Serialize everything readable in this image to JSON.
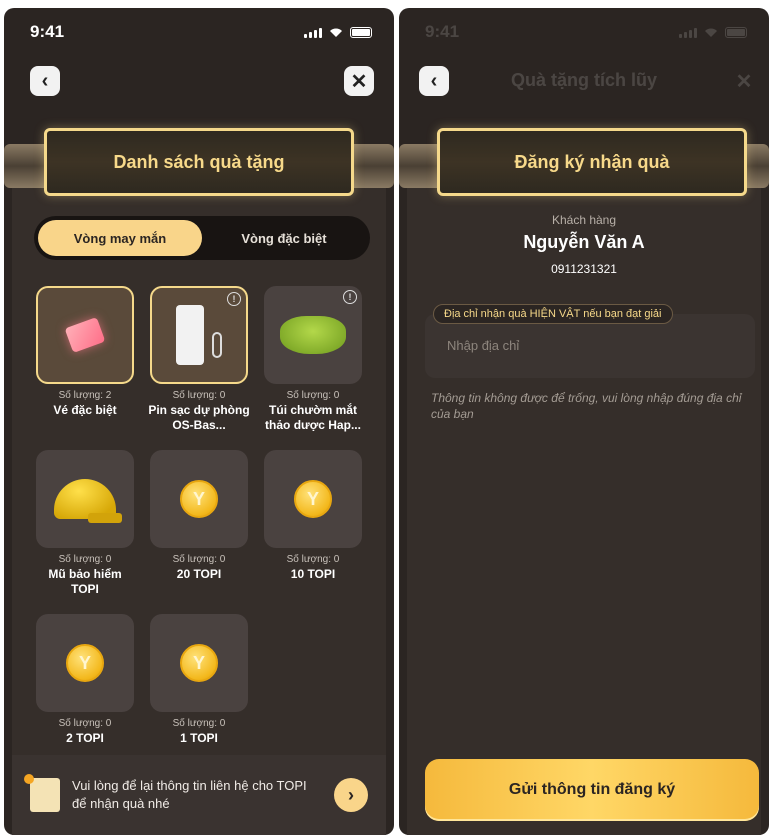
{
  "left": {
    "time": "9:41",
    "banner_title": "Danh sách quà tặng",
    "tabs": [
      {
        "label": "Vòng may mắn",
        "active": true
      },
      {
        "label": "Vòng đặc biệt",
        "active": false
      }
    ],
    "gifts": [
      {
        "qty": "Số lượng: 2",
        "name": "Vé đặc biệt",
        "icon": "ticket-icon"
      },
      {
        "qty": "Số lượng: 0",
        "name": "Pin sạc dự phòng OS-Bas...",
        "icon": "powerbank-icon"
      },
      {
        "qty": "Số lượng: 0",
        "name": "Túi chườm mắt thảo dược Hap...",
        "icon": "eye-mask-icon"
      },
      {
        "qty": "Số lượng: 0",
        "name": "Mũ bảo hiểm TOPI",
        "icon": "helmet-icon"
      },
      {
        "qty": "Số lượng: 0",
        "name": "20 TOPI",
        "icon": "coin-icon"
      },
      {
        "qty": "Số lượng: 0",
        "name": "10 TOPI",
        "icon": "coin-icon"
      },
      {
        "qty": "Số lượng: 0",
        "name": "2 TOPI",
        "icon": "coin-icon"
      },
      {
        "qty": "Số lượng: 0",
        "name": "1 TOPI",
        "icon": "coin-icon"
      }
    ],
    "footer_text": "Vui lòng để lại thông tin liên hệ cho TOPI để nhận quà nhé"
  },
  "right": {
    "time": "9:41",
    "screen_title": "Quà tặng tích lũy",
    "banner_title": "Đăng ký nhận quà",
    "customer_label": "Khách hàng",
    "customer_name": "Nguyễn Văn A",
    "customer_phone": "0911231321",
    "address_label": "Địa chỉ nhận quà HIỆN VẬT nếu bạn đạt giải",
    "address_placeholder": "Nhập địa chỉ",
    "hint": "Thông tin không được để trống, vui lòng nhập đúng địa chỉ của bạn",
    "submit_label": "Gửi thông tin đăng ký"
  },
  "colors": {
    "accent": "#f9d58a",
    "background": "#2b2522",
    "gold": "#f5d98b"
  }
}
